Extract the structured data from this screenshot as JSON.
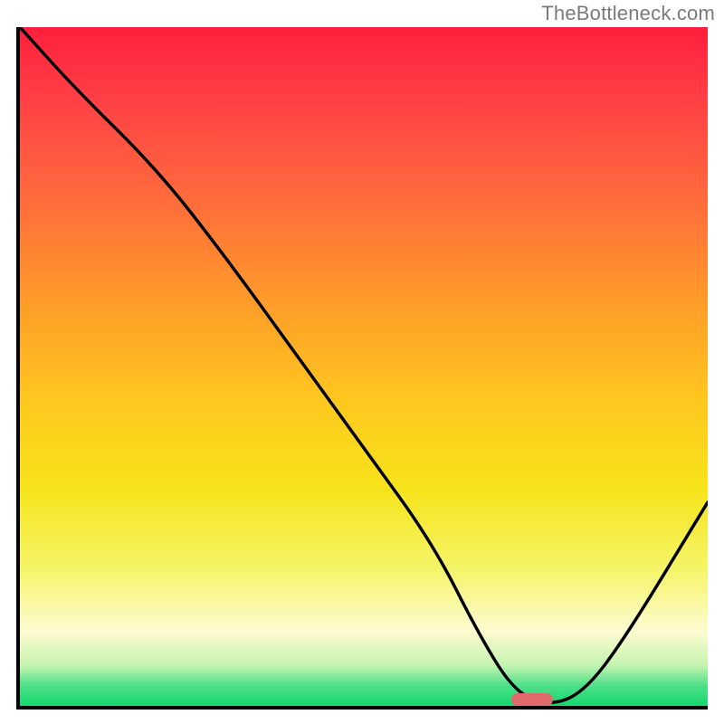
{
  "watermark": "TheBottleneck.com",
  "chart_data": {
    "type": "line",
    "title": "",
    "xlabel": "",
    "ylabel": "",
    "x_range": [
      0,
      100
    ],
    "y_range": [
      0,
      100
    ],
    "grid": false,
    "legend": false,
    "series": [
      {
        "name": "bottleneck-curve",
        "x": [
          0,
          8,
          20,
          30,
          40,
          50,
          60,
          67,
          72,
          77,
          82,
          88,
          100
        ],
        "y": [
          100,
          91,
          79,
          66,
          52,
          38,
          24,
          10,
          2,
          0,
          2,
          10,
          30
        ]
      }
    ],
    "marker": {
      "name": "optimal-point",
      "x_center": 74.5,
      "y": 0,
      "width_pct": 6
    },
    "colors": {
      "curve": "#000000",
      "marker": "#e06a6a",
      "gradient_top": "#ff1f3a",
      "gradient_bottom": "#14d86d"
    }
  }
}
